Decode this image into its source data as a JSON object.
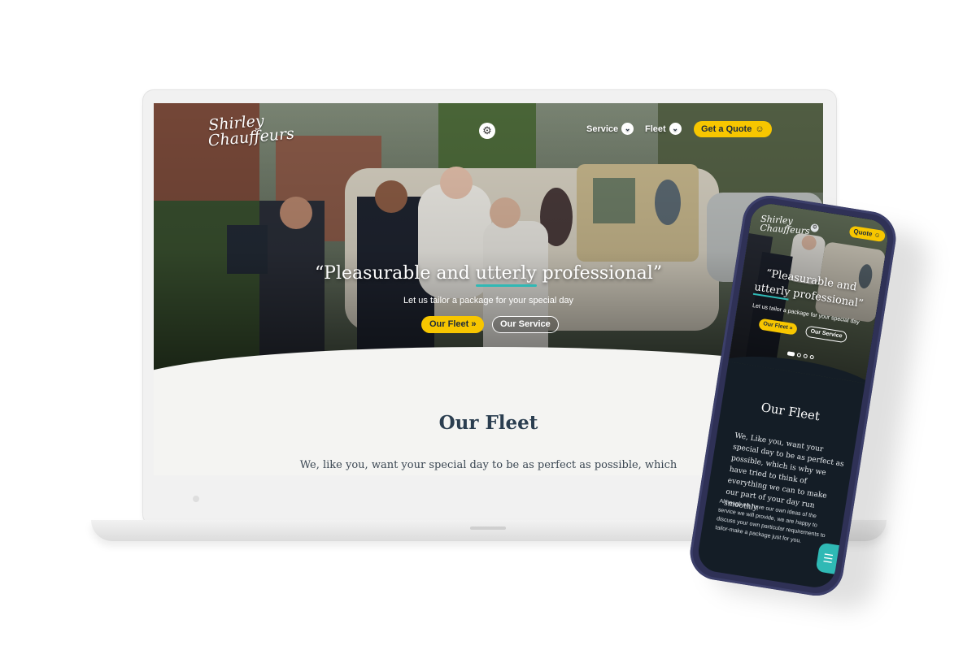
{
  "brand": {
    "line1": "Shirley",
    "line2": "Chauffeurs",
    "accent": "#f7c600",
    "teal": "#2fb9b5",
    "navy": "#2b3e50"
  },
  "desktop": {
    "nav": {
      "service": "Service",
      "fleet": "Fleet",
      "quote": "Get a Quote"
    },
    "hero": {
      "quote_open": "“Pleasurable and",
      "quote_highlight": "utterly",
      "quote_close": "professional”",
      "subtitle": "Let us tailor a package for your special day",
      "btn_fleet": "Our Fleet",
      "btn_service": "Our Service"
    },
    "section": {
      "title": "Our Fleet",
      "text": "We, like you, want your special day to be as perfect as possible, which"
    }
  },
  "mobile": {
    "nav": {
      "quote": "Quote"
    },
    "hero": {
      "quote_line1": "“Pleasurable and",
      "quote_highlight": "utterly",
      "quote_close": "professional”",
      "subtitle": "Let us tailor a package for your special day",
      "btn_fleet": "Our Fleet",
      "btn_service": "Our Service"
    },
    "section": {
      "title": "Our Fleet",
      "text1": "We, Like you, want your special day to be as perfect as possible, which is why we have tried to think of everything we can to make our part of your day run smoothly.",
      "text2": "Although we have our own ideas of the service we will provide, we are happy to discuss your own particular requirements to tailor-make a package just for you."
    }
  },
  "icons": {
    "settings": "gear-icon",
    "dropdown": "chevron-down-icon",
    "quote": "chat-icon",
    "scroll": "double-chevron-down-icon",
    "menu": "hamburger-icon"
  }
}
